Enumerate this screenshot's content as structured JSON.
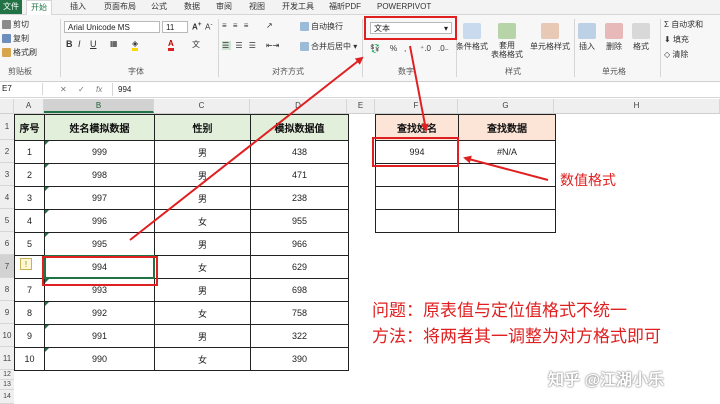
{
  "ribbon": {
    "tabs": [
      "文件",
      "开始",
      "插入",
      "页面布局",
      "公式",
      "数据",
      "审阅",
      "视图",
      "开发工具",
      "福昕PDF",
      "POWERPIVOT"
    ],
    "clipboard": {
      "cut": "剪切",
      "copy": "复制",
      "format_painter": "格式刷",
      "group": "剪贴板"
    },
    "font": {
      "name": "Arial Unicode MS",
      "size": "11",
      "group": "字体"
    },
    "alignment": {
      "wrap": "自动换行",
      "merge": "合并后居中",
      "group": "对齐方式"
    },
    "number": {
      "format": "文本",
      "group": "数字"
    },
    "styles": {
      "conditional": "条件格式",
      "table": "套用\n表格格式",
      "cell_styles": "单元格样式",
      "group": "样式"
    },
    "cells": {
      "insert": "插入",
      "delete": "删除",
      "format": "格式",
      "group": "单元格"
    },
    "editing": {
      "autosum": "自动求和",
      "fill": "填充",
      "clear": "清除"
    }
  },
  "formula_bar": {
    "name_box": "E7",
    "value": "994"
  },
  "columns": [
    "A",
    "B",
    "C",
    "D",
    "E",
    "F",
    "G",
    "H"
  ],
  "rows": [
    "1",
    "2",
    "3",
    "4",
    "5",
    "6",
    "7",
    "8",
    "9",
    "10",
    "11",
    "12",
    "13",
    "14"
  ],
  "main_table": {
    "headers": [
      "序号",
      "姓名模拟数据",
      "性别",
      "模拟数据值"
    ],
    "rows": [
      [
        "1",
        "999",
        "男",
        "438"
      ],
      [
        "2",
        "998",
        "男",
        "471"
      ],
      [
        "3",
        "997",
        "男",
        "238"
      ],
      [
        "4",
        "996",
        "女",
        "955"
      ],
      [
        "5",
        "995",
        "男",
        "966"
      ],
      [
        "6",
        "994",
        "女",
        "629"
      ],
      [
        "7",
        "993",
        "男",
        "698"
      ],
      [
        "8",
        "992",
        "女",
        "758"
      ],
      [
        "9",
        "991",
        "男",
        "322"
      ],
      [
        "10",
        "990",
        "女",
        "390"
      ]
    ]
  },
  "lookup_table": {
    "headers": [
      "查找姓名",
      "查找数据"
    ],
    "rows": [
      [
        "994",
        "#N/A"
      ],
      [
        "",
        ""
      ],
      [
        "",
        ""
      ],
      [
        "",
        ""
      ]
    ]
  },
  "annotations": {
    "numeric_format": "数值格式",
    "problem": "问题：原表值与定位值格式不统一",
    "method": "方法：将两者其一调整为对方格式即可",
    "watermark": "知乎 @江湖小乐"
  },
  "colors": {
    "excel_green": "#217346",
    "header_green": "#e2efda",
    "header_orange": "#fce4d6",
    "annotation_red": "#e02020"
  }
}
